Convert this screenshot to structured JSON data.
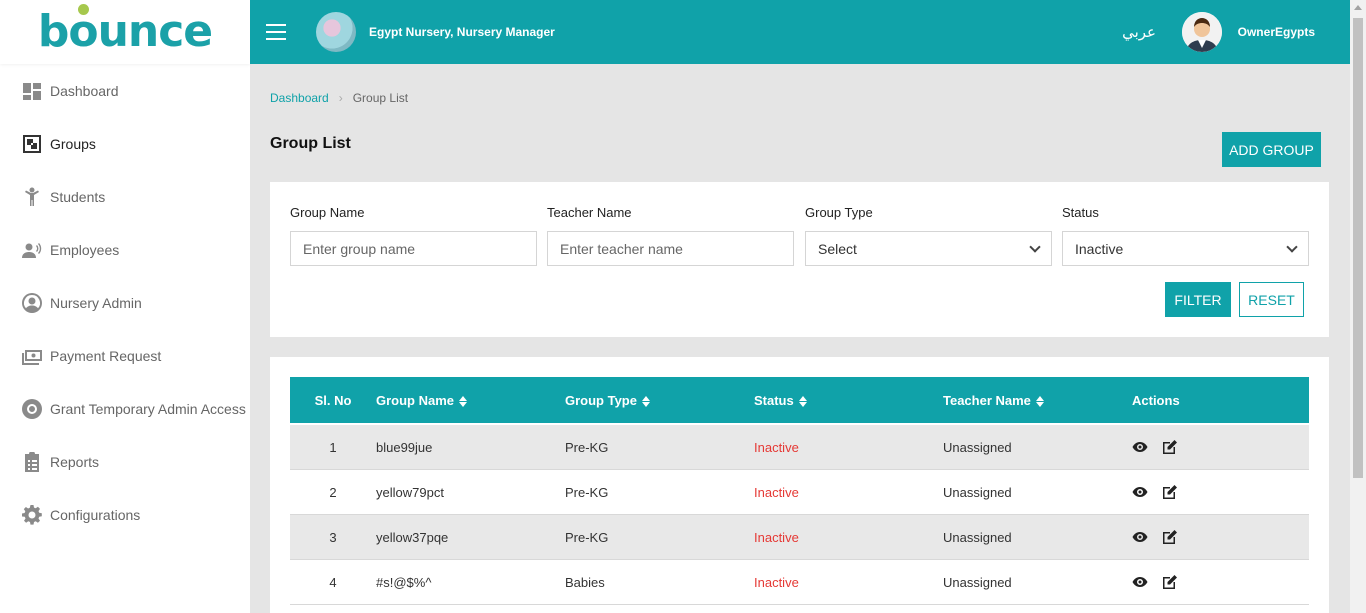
{
  "brand": {
    "logo_text_b": "b",
    "logo_text_o": "o",
    "logo_text_rest": "unce"
  },
  "sidebar": {
    "items": [
      {
        "label": "Dashboard",
        "icon": "dashboard-icon"
      },
      {
        "label": "Groups",
        "icon": "groups-icon",
        "active": true
      },
      {
        "label": "Students",
        "icon": "student-icon"
      },
      {
        "label": "Employees",
        "icon": "employee-icon"
      },
      {
        "label": "Nursery Admin",
        "icon": "user-circle-icon"
      },
      {
        "label": "Payment Request",
        "icon": "money-icon"
      },
      {
        "label": "Grant Temporary Admin Access",
        "icon": "lifebuoy-icon"
      },
      {
        "label": "Reports",
        "icon": "clipboard-icon"
      },
      {
        "label": "Configurations",
        "icon": "gear-icon"
      }
    ]
  },
  "header": {
    "org_name": "Egypt Nursery, Nursery Manager",
    "language": "عربي",
    "username": "OwnerEgypts"
  },
  "breadcrumb": {
    "home": "Dashboard",
    "current": "Group List"
  },
  "page": {
    "title": "Group List",
    "add_button": "ADD GROUP"
  },
  "filters": {
    "group_name": {
      "label": "Group Name",
      "placeholder": "Enter group name"
    },
    "teacher_name": {
      "label": "Teacher Name",
      "placeholder": "Enter teacher name"
    },
    "group_type": {
      "label": "Group Type",
      "value": "Select"
    },
    "status": {
      "label": "Status",
      "value": "Inactive"
    },
    "filter_button": "FILTER",
    "reset_button": "RESET"
  },
  "table": {
    "columns": [
      "Sl. No",
      "Group Name",
      "Group Type",
      "Status",
      "Teacher Name",
      "Actions"
    ],
    "rows": [
      {
        "no": "1",
        "name": "blue99jue",
        "type": "Pre-KG",
        "status": "Inactive",
        "teacher": "Unassigned"
      },
      {
        "no": "2",
        "name": "yellow79pct",
        "type": "Pre-KG",
        "status": "Inactive",
        "teacher": "Unassigned"
      },
      {
        "no": "3",
        "name": "yellow37pqe",
        "type": "Pre-KG",
        "status": "Inactive",
        "teacher": "Unassigned"
      },
      {
        "no": "4",
        "name": "#s!@$%^",
        "type": "Babies",
        "status": "Inactive",
        "teacher": "Unassigned"
      }
    ]
  },
  "colors": {
    "accent": "#10a2a9",
    "inactive": "#e53935",
    "logo_dot": "#a6c84d"
  }
}
